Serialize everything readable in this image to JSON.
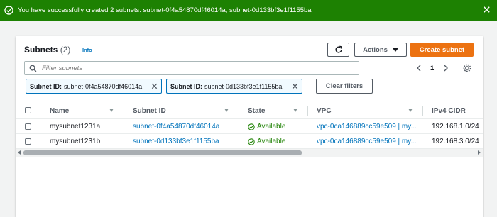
{
  "flash": {
    "message": "You have successfully created 2 subnets: subnet-0f4a54870df46014a, subnet-0d133bf3e1f1155ba",
    "status_color": "#1d8102",
    "status_icon": "success-circle-icon",
    "close_icon": "close-icon"
  },
  "header": {
    "title": "Subnets",
    "count": "(2)",
    "info_link": "Info",
    "refresh_icon": "refresh-icon",
    "actions_label": "Actions",
    "create_label": "Create subnet",
    "accent_color": "#ec7211"
  },
  "search": {
    "placeholder": "Filter subnets",
    "value": ""
  },
  "pagination": {
    "current_page": "1"
  },
  "filters": [
    {
      "key": "Subnet ID:",
      "value": "subnet-0f4a54870df46014a"
    },
    {
      "key": "Subnet ID:",
      "value": "subnet-0d133bf3e1f1155ba"
    }
  ],
  "clear_filters_label": "Clear filters",
  "table": {
    "columns": [
      "Name",
      "Subnet ID",
      "State",
      "VPC",
      "IPv4 CIDR"
    ],
    "rows": [
      {
        "name": "mysubnet1231a",
        "subnet_id": "subnet-0f4a54870df46014a",
        "state": "Available",
        "vpc": "vpc-0ca146889cc59e509 | my...",
        "cidr": "192.168.1.0/24"
      },
      {
        "name": "mysubnet1231b",
        "subnet_id": "subnet-0d133bf3e1f1155ba",
        "state": "Available",
        "vpc": "vpc-0ca146889cc59e509 | my...",
        "cidr": "192.168.3.0/24"
      }
    ]
  }
}
